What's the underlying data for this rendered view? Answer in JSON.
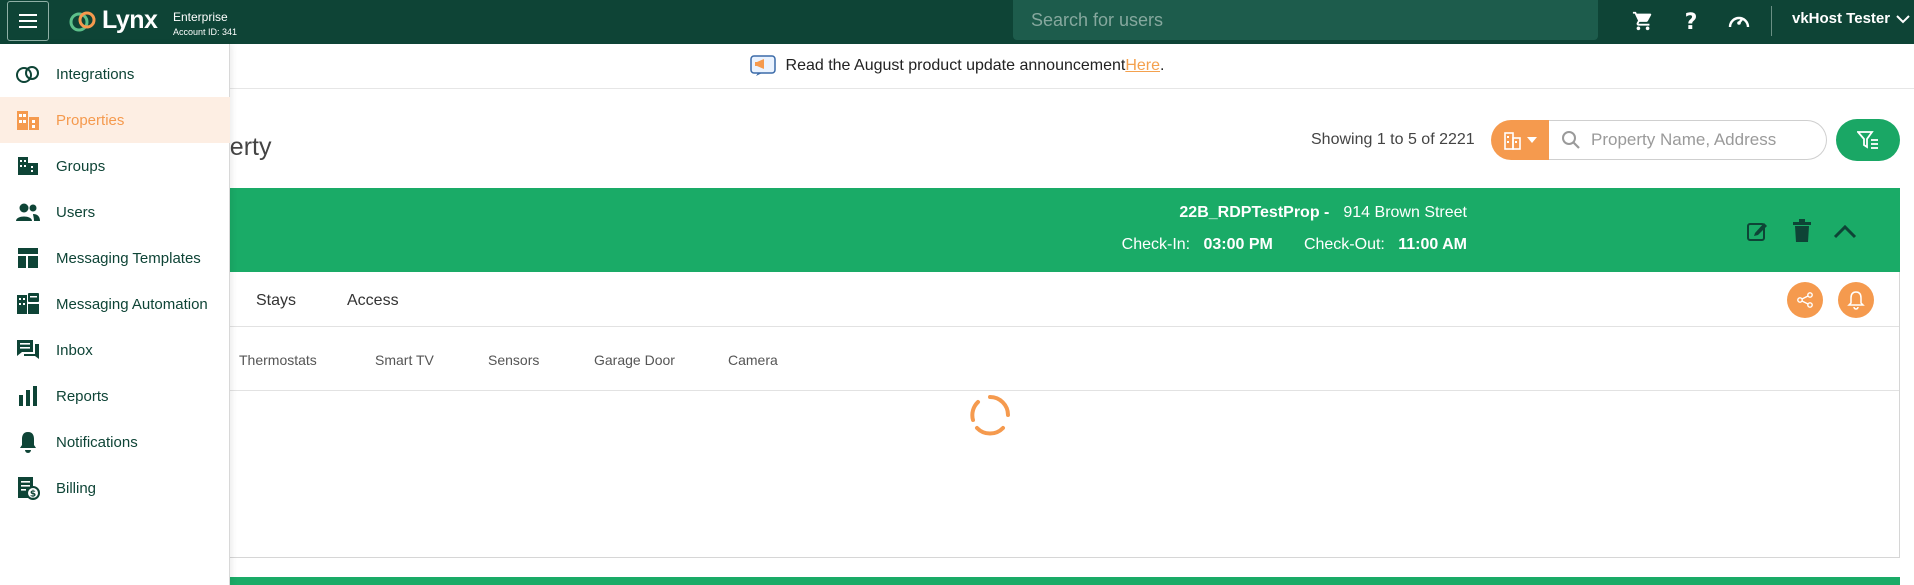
{
  "topbar": {
    "brand": "Lynx",
    "plan_name": "Enterprise",
    "account_id": "Account ID: 341",
    "search_placeholder": "Search for users",
    "user_name": "vkHost Tester"
  },
  "announcement": {
    "text": "Read the August product update announcement ",
    "link_text": "Here",
    "suffix": "."
  },
  "page": {
    "title": "operty",
    "showing": "Showing 1 to 5 of 2221",
    "property_search_placeholder": "Property Name, Address"
  },
  "property": {
    "name": "22B_RDPTestProp -",
    "address": "914 Brown Street",
    "checkin_label": "Check-In:",
    "checkin_time": "03:00 PM",
    "checkout_label": "Check-Out:",
    "checkout_time": "11:00 AM"
  },
  "tabs": [
    "Stays",
    "Access"
  ],
  "subtabs": [
    "Thermostats",
    "Smart TV",
    "Sensors",
    "Garage Door",
    "Camera"
  ],
  "sidebar": {
    "items": [
      {
        "label": "Integrations",
        "icon": "integrations-icon"
      },
      {
        "label": "Properties",
        "icon": "properties-icon",
        "active": true
      },
      {
        "label": "Groups",
        "icon": "groups-icon"
      },
      {
        "label": "Users",
        "icon": "users-icon"
      },
      {
        "label": "Messaging Templates",
        "icon": "templates-icon"
      },
      {
        "label": "Messaging Automation",
        "icon": "automation-icon"
      },
      {
        "label": "Inbox",
        "icon": "inbox-icon"
      },
      {
        "label": "Reports",
        "icon": "reports-icon"
      },
      {
        "label": "Notifications",
        "icon": "bell-icon"
      },
      {
        "label": "Billing",
        "icon": "billing-icon"
      }
    ]
  },
  "colors": {
    "topbar": "#0e4436",
    "accent_green": "#1aab67",
    "accent_orange": "#f59a4e",
    "active_item_bg": "#fdeee3"
  }
}
